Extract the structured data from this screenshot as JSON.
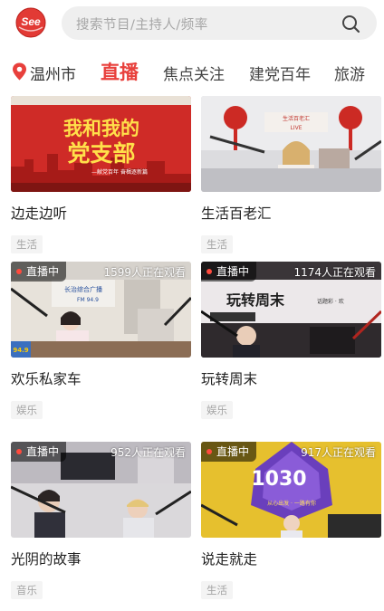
{
  "header": {
    "logo_text": "See",
    "search_placeholder": "搜索节目/主持人/频率"
  },
  "nav": {
    "city": "温州市",
    "tabs": [
      {
        "label": "直播",
        "active": true
      },
      {
        "label": "焦点关注",
        "active": false
      },
      {
        "label": "建党百年",
        "active": false
      },
      {
        "label": "旅游",
        "active": false
      }
    ]
  },
  "cards": [
    {
      "title": "边走边听",
      "tag": "生活",
      "live_label": "",
      "viewers": "",
      "thumb_text": "我和我的党支部"
    },
    {
      "title": "生活百老汇",
      "tag": "生活",
      "live_label": "",
      "viewers": "",
      "thumb_text": ""
    },
    {
      "title": "欢乐私家车",
      "tag": "娱乐",
      "live_label": "直播中",
      "viewers": "1599人正在观看",
      "thumb_text": "长治综合广播 FM 94.9"
    },
    {
      "title": "玩转周末",
      "tag": "娱乐",
      "live_label": "直播中",
      "viewers": "1174人正在观看",
      "thumb_text": "玩转周末"
    },
    {
      "title": "光阴的故事",
      "tag": "音乐",
      "live_label": "直播中",
      "viewers": "952人正在观看",
      "thumb_text": ""
    },
    {
      "title": "说走就走",
      "tag": "生活",
      "live_label": "直播中",
      "viewers": "917人正在观看",
      "thumb_text": "1030"
    }
  ],
  "colors": {
    "accent": "#e8403c",
    "tag_bg": "#f4f4f4",
    "tag_text": "#a4a4a4",
    "search_bg": "#efefef"
  }
}
